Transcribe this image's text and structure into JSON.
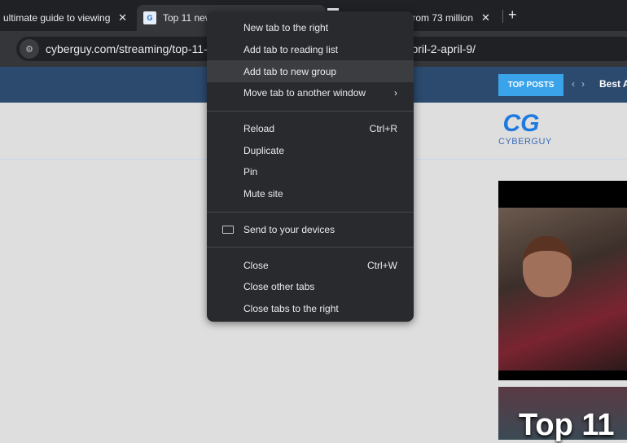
{
  "tabs": [
    {
      "title": "ultimate guide to viewing t",
      "close": "✕"
    },
    {
      "title": "Top 11 new",
      "close": ""
    },
    {
      "title": "from 73 million",
      "close": "✕"
    }
  ],
  "new_tab": "+",
  "address": {
    "url_start": "cyberguy.com/streaming/top-11-n",
    "url_end": "k-april-2-april-9/",
    "tune_icon": "⚙"
  },
  "site": {
    "top_posts": "TOP POSTS",
    "prev": "‹",
    "next": "›",
    "best": "Best A",
    "logo_text": "CYBERGUY",
    "logo_mark": "CG",
    "thumb_title": "Top 11"
  },
  "menu": {
    "group1": [
      {
        "label": "New tab to the right"
      },
      {
        "label": "Add tab to reading list"
      },
      {
        "label": "Add tab to new group"
      },
      {
        "label": "Move tab to another window",
        "arrow": "›"
      }
    ],
    "group2": [
      {
        "label": "Reload",
        "shortcut": "Ctrl+R"
      },
      {
        "label": "Duplicate"
      },
      {
        "label": "Pin"
      },
      {
        "label": "Mute site"
      }
    ],
    "group3": [
      {
        "label": "Send to your devices"
      }
    ],
    "group4": [
      {
        "label": "Close",
        "shortcut": "Ctrl+W"
      },
      {
        "label": "Close other tabs"
      },
      {
        "label": "Close tabs to the right"
      }
    ]
  }
}
